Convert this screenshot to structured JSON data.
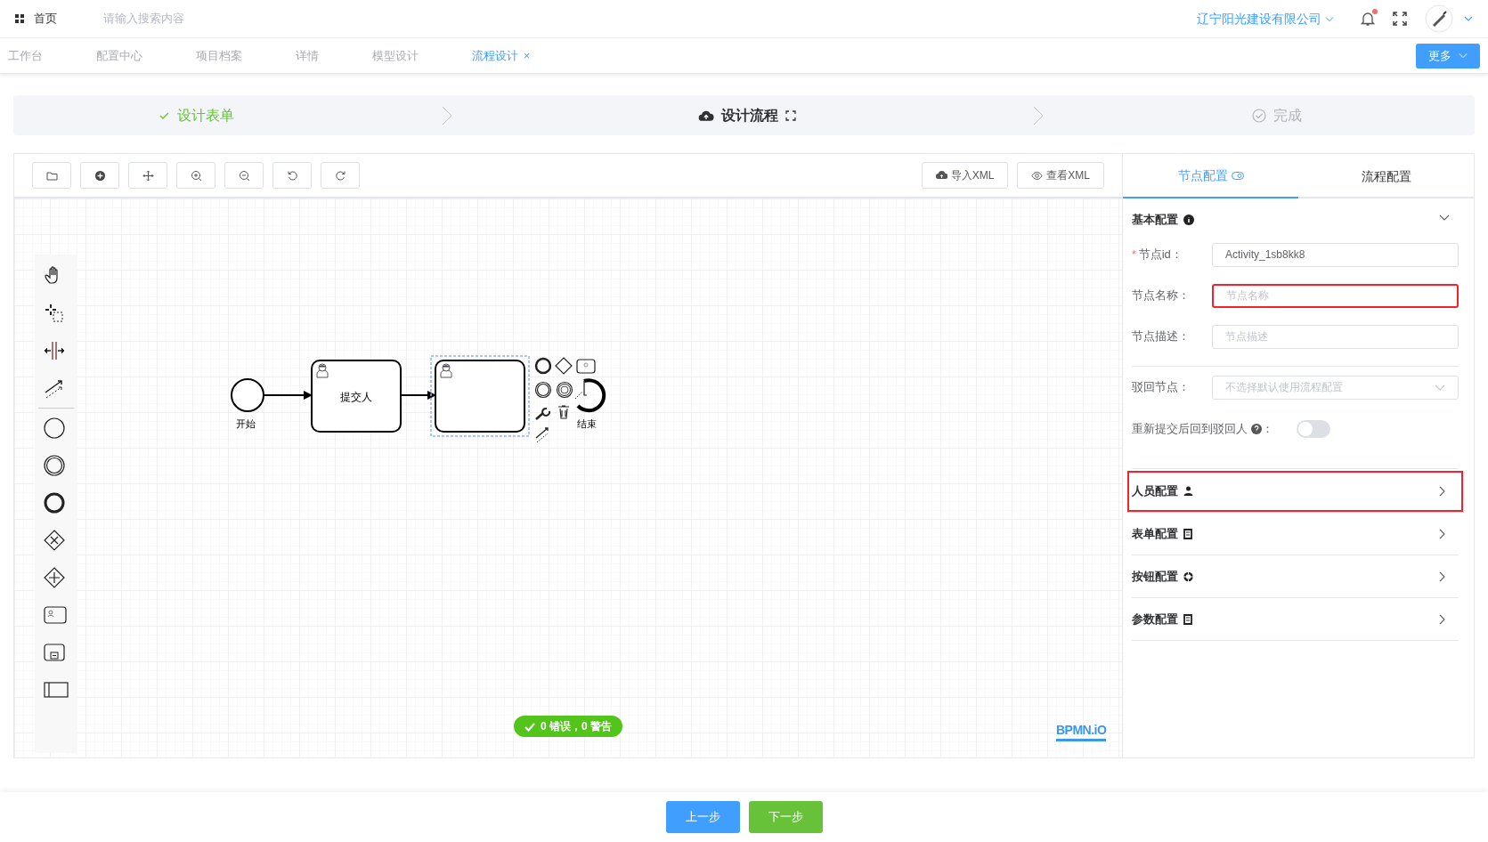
{
  "header": {
    "home": "首页",
    "search": {
      "placeholder": "请输入搜索内容"
    },
    "company": "辽宁阳光建设有限公司",
    "notification_dot": true
  },
  "tabs": [
    {
      "label": "工作台",
      "selected": false
    },
    {
      "label": "配置中心",
      "selected": false
    },
    {
      "label": "项目档案",
      "selected": false
    },
    {
      "label": "详情",
      "selected": false
    },
    {
      "label": "模型设计",
      "selected": false
    },
    {
      "label": "流程设计",
      "selected": true,
      "close": "×"
    }
  ],
  "more_button": "更多",
  "steps": [
    {
      "label": "设计表单",
      "completed": true,
      "selected": false
    },
    {
      "label": "设计流程",
      "selected": true
    },
    {
      "label": "完成",
      "completed": false,
      "selected": false
    }
  ],
  "toolbar": {
    "buttons": [
      "导入XML",
      "查看XML"
    ]
  },
  "diagram": {
    "nodes": [
      {
        "kind": "start",
        "label": "开始",
        "selected": false
      },
      {
        "kind": "task",
        "label": "提交人",
        "selected": false
      },
      {
        "kind": "task",
        "selected": true
      },
      {
        "kind": "end",
        "label": "结束",
        "selected": false
      }
    ],
    "validation": "0 错误，0 警告",
    "logo": "BPMN.iO"
  },
  "panel": {
    "tabs": [
      {
        "label": "节点配置",
        "selected": true
      },
      {
        "label": "流程配置",
        "selected": false
      }
    ],
    "basic": {
      "title": "基本配置",
      "expanded": true,
      "fields": [
        {
          "kind": "input",
          "label": "节点id：",
          "required_mark": "*",
          "value": "Activity_1sb8kk8",
          "highlighted": false
        },
        {
          "kind": "input",
          "label": "节点名称：",
          "placeholder": "节点名称",
          "highlighted": true
        },
        {
          "kind": "input",
          "label": "节点描述：",
          "placeholder": "节点描述",
          "highlighted": false
        },
        {
          "kind": "select",
          "label": "驳回节点：",
          "placeholder": "不选择默认使用流程配置",
          "highlighted": false
        },
        {
          "kind": "switch",
          "label": "重新提交后回到驳回人",
          "suffix": "：",
          "on": false
        }
      ]
    },
    "sections": [
      {
        "title": "人员配置",
        "expanded": false,
        "highlighted": true
      },
      {
        "title": "表单配置",
        "expanded": false,
        "highlighted": false
      },
      {
        "title": "按钮配置",
        "expanded": false,
        "highlighted": false
      },
      {
        "title": "参数配置",
        "expanded": false,
        "highlighted": false
      }
    ]
  },
  "footer": {
    "buttons": [
      {
        "label": "上一步",
        "kind": "primary"
      },
      {
        "label": "下一步",
        "kind": "success"
      }
    ]
  }
}
